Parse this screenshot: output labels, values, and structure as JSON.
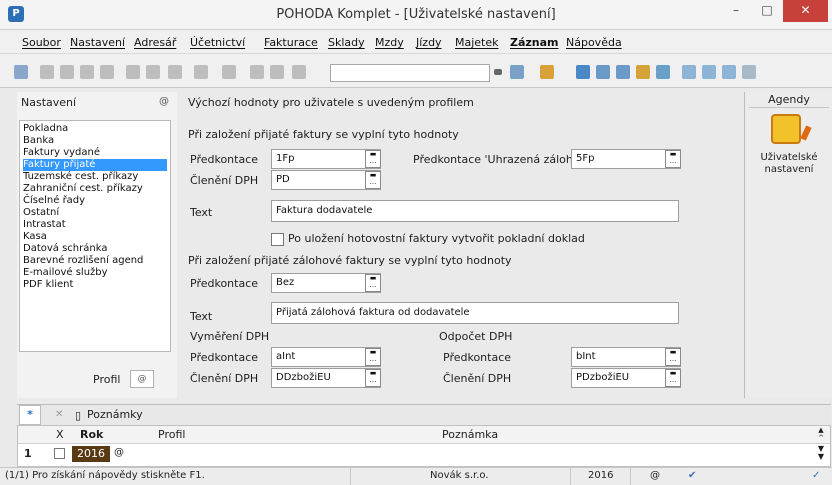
{
  "window": {
    "title": "POHODA Komplet - [Uživatelské nastavení]",
    "icon": "app-icon",
    "min": "–",
    "max": "□",
    "close": "✕"
  },
  "menu": [
    {
      "id": "soubor",
      "label": "Soubor"
    },
    {
      "id": "nastaveni",
      "label": "Nastavení"
    },
    {
      "id": "adresar",
      "label": "Adresář"
    },
    {
      "id": "ucetnictvi",
      "label": "Účetnictví"
    },
    {
      "id": "fakturace",
      "label": "Fakturace"
    },
    {
      "id": "sklady",
      "label": "Sklady"
    },
    {
      "id": "mzdy",
      "label": "Mzdy"
    },
    {
      "id": "jizdy",
      "label": "Jízdy"
    },
    {
      "id": "majetek",
      "label": "Majetek"
    },
    {
      "id": "zaznam",
      "label": "Záznam"
    },
    {
      "id": "napoveda",
      "label": "Nápověda"
    }
  ],
  "left": {
    "heading": "Nastavení",
    "at": "@",
    "items": [
      "Pokladna",
      "Banka",
      "Faktury vydané",
      "Faktury přijaté",
      "Tuzemské cest. příkazy",
      "Zahraniční cest. příkazy",
      "Číselné řady",
      "Ostatní",
      "Intrastat",
      "Kasa",
      "Datová schránka",
      "Barevné rozlišení agend",
      "E-mailové služby",
      "PDF klient"
    ],
    "selected_index": 3,
    "profil_label": "Profil",
    "profil_value": "@"
  },
  "form": {
    "header": "Výchozí hodnoty pro uživatele s uvedeným profilem",
    "section1": "Při založení přijaté faktury se vyplní tyto hodnoty",
    "predkontace_label": "Předkontace",
    "predkontace_value": "1Fp",
    "cleneni_label": "Členění DPH",
    "cleneni_value": "PD",
    "uhrazena_label": "Předkontace 'Uhrazená záloha'",
    "uhrazena_value": "5Fp",
    "text_label": "Text",
    "text_value": "Faktura dodavatele",
    "checkbox_label": "Po uložení hotovostní faktury vytvořit pokladní doklad",
    "section2": "Při založení přijaté zálohové faktury se vyplní tyto hodnoty",
    "zal_predkontace_label": "Předkontace",
    "zal_predkontace_value": "Bez",
    "zal_text_label": "Text",
    "zal_text_value": "Přijatá zálohová faktura od dodavatele",
    "vymereni_heading": "Vyměření DPH",
    "vym_predkontace_label": "Předkontace",
    "vym_predkontace_value": "aInt",
    "vym_cleneni_label": "Členění DPH",
    "vym_cleneni_value": "DDzbožiEU",
    "odpocet_heading": "Odpočet DPH",
    "odp_predkontace_label": "Předkontace",
    "odp_predkontace_value": "bInt",
    "odp_cleneni_label": "Členění DPH",
    "odp_cleneni_value": "PDzbožiEU"
  },
  "agendy": {
    "heading": "Agendy",
    "item_label": "Uživatelské nastavení"
  },
  "bottom": {
    "tabs": [
      {
        "label": "*"
      },
      {
        "label": "Poznámky"
      }
    ],
    "columns": {
      "x": "X",
      "rok": "Rok",
      "profil": "Profil",
      "poznamka": "Poznámka"
    },
    "row": {
      "num": "1",
      "rok": "2016",
      "profil": "@"
    }
  },
  "status": {
    "help": "(1/1) Pro získání nápovědy stiskněte F1.",
    "company": "Novák s.r.o.",
    "year": "2016",
    "at": "@"
  }
}
